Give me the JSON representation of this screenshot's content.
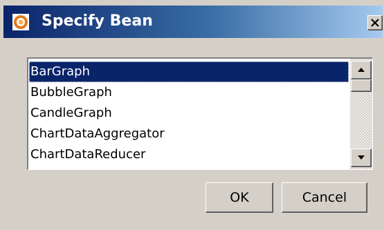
{
  "window": {
    "title": "Specify Bean",
    "close_symbol": "✕"
  },
  "bean_list": {
    "items": [
      "BarGraph",
      "BubbleGraph",
      "CandleGraph",
      "ChartDataAggregator",
      "ChartDataReducer"
    ],
    "selected_index": 0
  },
  "buttons": {
    "ok_label": "OK",
    "cancel_label": "Cancel"
  },
  "icons": {
    "app": "java-coffee-icon",
    "close": "close-icon",
    "scroll_up": "arrow-up-icon",
    "scroll_down": "arrow-down-icon"
  },
  "colors": {
    "titlebar_start": "#0a246a",
    "titlebar_end": "#a6caf0",
    "selection": "#0a246a",
    "face": "#d4d0c8"
  }
}
